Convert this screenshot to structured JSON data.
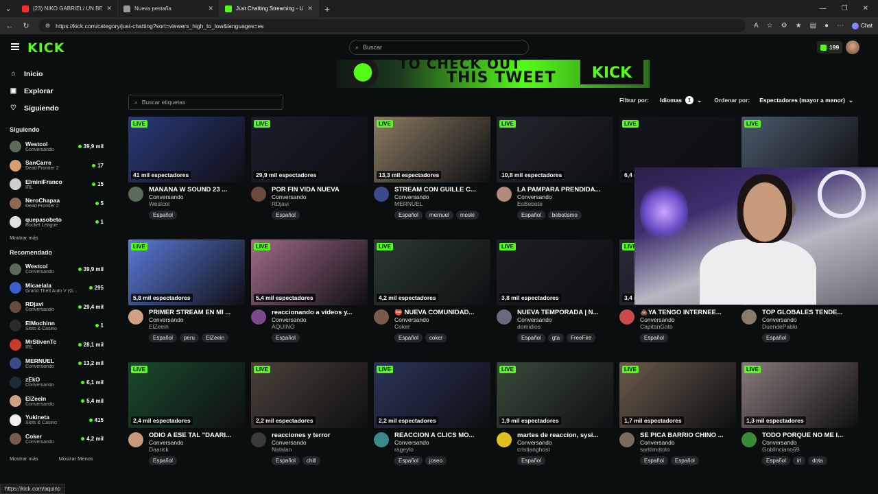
{
  "browser": {
    "tabs": [
      {
        "title": "(23) NIKO GABRIEL/ UN BESO (pr...",
        "icon": "youtube-icon",
        "color": "#ff2a2a",
        "active": false
      },
      {
        "title": "Nueva pestaña",
        "icon": "newtab-icon",
        "color": "#9a9a9a",
        "active": false
      },
      {
        "title": "Just Chatting Streaming - Live Str...",
        "icon": "kick-icon",
        "color": "#53fc18",
        "active": true
      }
    ],
    "url": "https://kick.com/category/just-chatting?sort=viewers_high_to_low&languages=es",
    "chat_label": "Chat",
    "status_url": "https://kick.com/aquino"
  },
  "header": {
    "logo": "KICK",
    "search_placeholder": "Buscar",
    "points": "199"
  },
  "banner": {
    "line1": "TO CHECK OUT",
    "line2": "THIS TWEET",
    "cta": "KICK"
  },
  "sidebar": {
    "nav": [
      {
        "label": "Inicio",
        "icon": "home-icon",
        "glyph": "⌂"
      },
      {
        "label": "Explorar",
        "icon": "explore-icon",
        "glyph": "▣"
      },
      {
        "label": "Siguiendo",
        "icon": "heart-icon",
        "glyph": "♡"
      }
    ],
    "following_title": "Siguiendo",
    "following": [
      {
        "name": "Westcol",
        "category": "Conversando",
        "viewers": "39,9 mil",
        "color": "#5a6b5a"
      },
      {
        "name": "SanCarre",
        "category": "Dead Frontier 2",
        "viewers": "17",
        "color": "#d8a070"
      },
      {
        "name": "ElminiFranco",
        "category": "IRL",
        "viewers": "15",
        "color": "#cfcfcf"
      },
      {
        "name": "NeroChapaa",
        "category": "Dead Frontier 2",
        "viewers": "5",
        "color": "#8a6a50"
      },
      {
        "name": "quepasobeto",
        "category": "Rocket League",
        "viewers": "1",
        "color": "#e0e0e0"
      }
    ],
    "show_more": "Mostrar más",
    "recommended_title": "Recomendado",
    "recommended": [
      {
        "name": "Westcol",
        "category": "Conversando",
        "viewers": "39,9 mil",
        "color": "#5a6b5a"
      },
      {
        "name": "Micaelala",
        "category": "Grand Theft Auto V (G...",
        "viewers": "295",
        "color": "#3a5fcf"
      },
      {
        "name": "RDjavi",
        "category": "Conversando",
        "viewers": "29,4 mil",
        "color": "#6a4a3a"
      },
      {
        "name": "ElMochinn",
        "category": "Slots & Casino",
        "viewers": "1",
        "color": "#2a2a2a"
      },
      {
        "name": "MrStivenTc",
        "category": "IRL",
        "viewers": "28,1 mil",
        "color": "#c83a2a"
      },
      {
        "name": "MERNUEL",
        "category": "Conversando",
        "viewers": "13,2 mil",
        "color": "#3a4a8a"
      },
      {
        "name": "zEkO",
        "category": "Conversando",
        "viewers": "6,1 mil",
        "color": "#1e2a3a"
      },
      {
        "name": "ElZeein",
        "category": "Conversando",
        "viewers": "5,4 mil",
        "color": "#d0a080"
      },
      {
        "name": "Yukineta",
        "category": "Slots & Casino",
        "viewers": "415",
        "color": "#f0f0f0"
      },
      {
        "name": "Coker",
        "category": "Conversando",
        "viewers": "4,2 mil",
        "color": "#7a5a4a"
      }
    ],
    "show_more_2": "Mostrar más",
    "show_less": "Mostrar Menos"
  },
  "main": {
    "tag_search_placeholder": "Buscar etiquetas",
    "filter_label": "Filtrar por:",
    "languages_label": "Idiomas",
    "languages_count": "1",
    "sort_label": "Ordenar por:",
    "sort_value": "Espectadores (mayor a menor)",
    "live_label": "LIVE",
    "streams": [
      {
        "viewers": "41 mil espectadores",
        "title": "MAÑANA W SOUND 23 ...",
        "category": "Conversando",
        "streamer": "Westcol",
        "tags": [
          "Español"
        ],
        "thumb": "#2b3a7a",
        "avatar": "#5a6b5a"
      },
      {
        "viewers": "29,9 mil espectadores",
        "title": "POR FIN VIDA NUEVA",
        "category": "Conversando",
        "streamer": "RDjavi",
        "tags": [
          "Español"
        ],
        "thumb": "#1a1d2a",
        "avatar": "#6a4a3a"
      },
      {
        "viewers": "13,3 mil espectadores",
        "title": "STREAM CON GUILLE C...",
        "category": "Conversando",
        "streamer": "MERNUEL",
        "tags": [
          "Español",
          "mernuel",
          "moski"
        ],
        "thumb": "#8a7a62",
        "avatar": "#3a4a8a"
      },
      {
        "viewers": "10,8 mil espectadores",
        "title": "LA PAMPARA PRENDIDA...",
        "category": "Conversando",
        "streamer": "EsBebote",
        "tags": [
          "Español",
          "bebotismo"
        ],
        "thumb": "#23262e",
        "avatar": "#b08a7a"
      },
      {
        "viewers": "6,4 mil espectadores",
        "title": "",
        "category": "",
        "streamer": "",
        "tags": [],
        "thumb": "#14141c",
        "avatar": "#3a5a8a"
      },
      {
        "viewers": "",
        "title": "",
        "category": "",
        "streamer": "",
        "tags": [],
        "thumb": "#4a5a6a",
        "avatar": "#555"
      },
      {
        "viewers": "5,8 mil espectadores",
        "title": "PRIMER STREAM EN MI ...",
        "category": "Conversando",
        "streamer": "ElZeein",
        "tags": [
          "Español",
          "peru",
          "ElZeein"
        ],
        "thumb": "#5a7ad8",
        "avatar": "#d0a080"
      },
      {
        "viewers": "5,4 mil espectadores",
        "title": "reaccionando a videos y...",
        "category": "Conversando",
        "streamer": "AQUINO",
        "tags": [
          "Español"
        ],
        "thumb": "#a06a8a",
        "avatar": "#7a4a8a"
      },
      {
        "viewers": "4,2 mil espectadores",
        "title": "⛔ NUEVA COMUNIDAD...",
        "category": "Conversando",
        "streamer": "Coker",
        "tags": [
          "Español",
          "coker"
        ],
        "thumb": "#2a3a34",
        "avatar": "#7a5a4a"
      },
      {
        "viewers": "3,8 mil espectadores",
        "title": "NUEVA TEMPORADA | N...",
        "category": "Conversando",
        "streamer": "domidios",
        "tags": [
          "Español",
          "gta",
          "FreeFire"
        ],
        "thumb": "#1e1e24",
        "avatar": "#6a6a7a"
      },
      {
        "viewers": "3,4 mil espectadores",
        "title": "💩YA TENGO INTERNEE...",
        "category": "Conversando",
        "streamer": "CapitanGato",
        "tags": [
          "Español"
        ],
        "thumb": "#2a2a3a",
        "avatar": "#c84a4a"
      },
      {
        "viewers": "",
        "title": "TOP GLOBALES TENDE...",
        "category": "Conversando",
        "streamer": "DuendePablo",
        "tags": [
          "Español"
        ],
        "thumb": "#3a3a4a",
        "avatar": "#8a7a6a"
      },
      {
        "viewers": "2,4 mil espectadores",
        "title": "ODIO A ESE TAL \"DAARI...",
        "category": "Conversando",
        "streamer": "Daarick",
        "tags": [
          "Español"
        ],
        "thumb": "#1a4a2a",
        "avatar": "#c89a7a"
      },
      {
        "viewers": "2,2 mil espectadores",
        "title": "reacciones y terror",
        "category": "Conversando",
        "streamer": "Natalan",
        "tags": [
          "Español",
          "chill"
        ],
        "thumb": "#4a4038",
        "avatar": "#3a3a3a"
      },
      {
        "viewers": "2,2 mil espectadores",
        "title": "REACCION A CLICS MO...",
        "category": "Conversando",
        "streamer": "rageylo",
        "tags": [
          "Español",
          "joseo"
        ],
        "thumb": "#2a3458",
        "avatar": "#3a8a8a"
      },
      {
        "viewers": "1,9 mil espectadores",
        "title": "martes de reaccion, sysi...",
        "category": "Conversando",
        "streamer": "cristianghost",
        "tags": [
          "Español"
        ],
        "thumb": "#3a4a3a",
        "avatar": "#e0c020"
      },
      {
        "viewers": "1,7 mil espectadores",
        "title": "SE PICA BARRIO CHINO ...",
        "category": "Conversando",
        "streamer": "santimotolo",
        "tags": [
          "Español",
          "Español"
        ],
        "thumb": "#6a5a4a",
        "avatar": "#7a6a5a"
      },
      {
        "viewers": "1,3 mil espectadores",
        "title": "TODO PORQUE NO ME I...",
        "category": "Conversando",
        "streamer": "Goblinciano69",
        "tags": [
          "Español",
          "irl",
          "dota"
        ],
        "thumb": "#8a7a7a",
        "avatar": "#3a8a3a"
      }
    ]
  }
}
